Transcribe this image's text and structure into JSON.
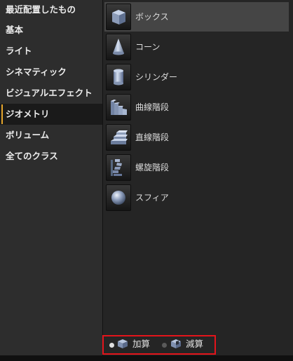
{
  "sidebar": {
    "categories": [
      {
        "label": "最近配置したもの"
      },
      {
        "label": "基本"
      },
      {
        "label": "ライト"
      },
      {
        "label": "シネマティック"
      },
      {
        "label": "ビジュアルエフェクト"
      },
      {
        "label": "ジオメトリ",
        "selected": true
      },
      {
        "label": "ボリューム"
      },
      {
        "label": "全てのクラス"
      }
    ]
  },
  "main": {
    "items": [
      {
        "label": "ボックス",
        "icon": "box-icon",
        "selected": true
      },
      {
        "label": "コーン",
        "icon": "cone-icon"
      },
      {
        "label": "シリンダー",
        "icon": "cylinder-icon"
      },
      {
        "label": "曲線階段",
        "icon": "curved-stairs-icon"
      },
      {
        "label": "直線階段",
        "icon": "linear-stairs-icon"
      },
      {
        "label": "螺旋階段",
        "icon": "spiral-stairs-icon"
      },
      {
        "label": "スフィア",
        "icon": "sphere-icon"
      }
    ]
  },
  "brush_mode": {
    "additive_label": "加算",
    "subtractive_label": "減算",
    "selected": "additive",
    "highlight_color": "#e4141b"
  },
  "colors": {
    "accent": "#e5a52c",
    "sidebar_bg": "#2d2d2d",
    "panel_bg": "#252525"
  }
}
